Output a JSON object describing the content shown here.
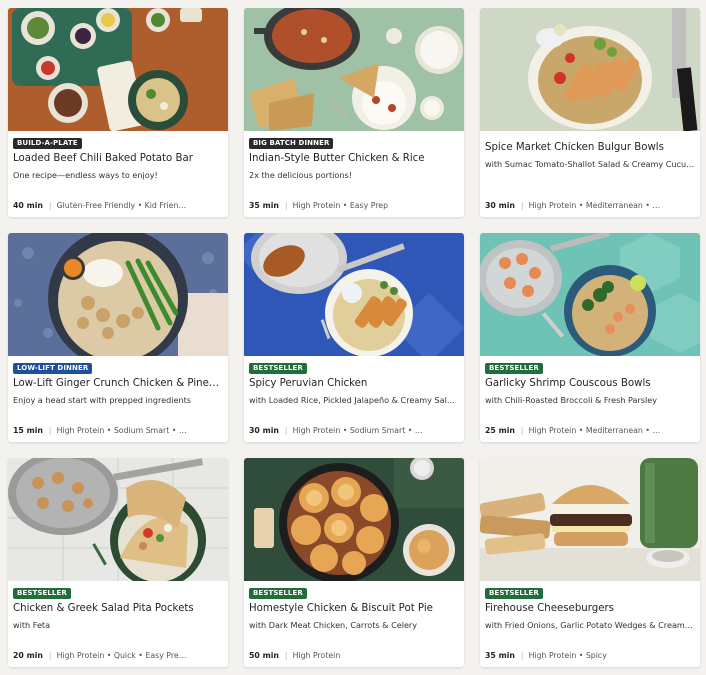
{
  "colors": {
    "badge_dark": "#2a2a2a",
    "badge_blue": "#1f4f9e",
    "badge_green": "#216e3a"
  },
  "recipes": [
    {
      "badge": "BUILD-A-PLATE",
      "badge_color": "#2a2a2a",
      "title": "Loaded Beef Chili Baked Potato Bar",
      "subtitle": "One recipe—endless ways to enjoy!",
      "time": "40 min",
      "tags": "Gluten-Free Friendly • Kid Frien…"
    },
    {
      "badge": "BIG BATCH DINNER",
      "badge_color": "#2a2a2a",
      "title": "Indian-Style Butter Chicken & Rice",
      "subtitle": "2x the delicious portions!",
      "time": "35 min",
      "tags": "High Protein • Easy Prep"
    },
    {
      "badge": "",
      "title": "Spice Market Chicken Bulgur Bowls",
      "subtitle": "with Sumac Tomato-Shallot Salad & Creamy Cucum…",
      "time": "30 min",
      "tags": "High Protein • Mediterranean • …"
    },
    {
      "badge": "LOW-LIFT DINNER",
      "badge_color": "#1f4f9e",
      "title": "Low-Lift Ginger Crunch Chicken & Pinea…",
      "subtitle": "Enjoy a head start with prepped ingredients",
      "time": "15 min",
      "tags": "High Protein • Sodium Smart • …"
    },
    {
      "badge": "BESTSELLER",
      "badge_color": "#216e3a",
      "title": "Spicy Peruvian Chicken",
      "subtitle": "with Loaded Rice, Pickled Jalapeño & Creamy Salsa…",
      "time": "30 min",
      "tags": "High Protein • Sodium Smart • …"
    },
    {
      "badge": "BESTSELLER",
      "badge_color": "#216e3a",
      "title": "Garlicky Shrimp Couscous Bowls",
      "subtitle": "with Chili-Roasted Broccoli & Fresh Parsley",
      "time": "25 min",
      "tags": "High Protein • Mediterranean • …"
    },
    {
      "badge": "BESTSELLER",
      "badge_color": "#216e3a",
      "title": "Chicken & Greek Salad Pita Pockets",
      "subtitle": "with Feta",
      "time": "20 min",
      "tags": "High Protein • Quick • Easy Pre…"
    },
    {
      "badge": "BESTSELLER",
      "badge_color": "#216e3a",
      "title": "Homestyle Chicken & Biscuit Pot Pie",
      "subtitle": "with Dark Meat Chicken, Carrots & Celery",
      "time": "50 min",
      "tags": "High Protein"
    },
    {
      "badge": "BESTSELLER",
      "badge_color": "#216e3a",
      "title": "Firehouse Cheeseburgers",
      "subtitle": "with Fried Onions, Garlic Potato Wedges & Creamy …",
      "time": "35 min",
      "tags": "High Protein • Spicy"
    }
  ]
}
